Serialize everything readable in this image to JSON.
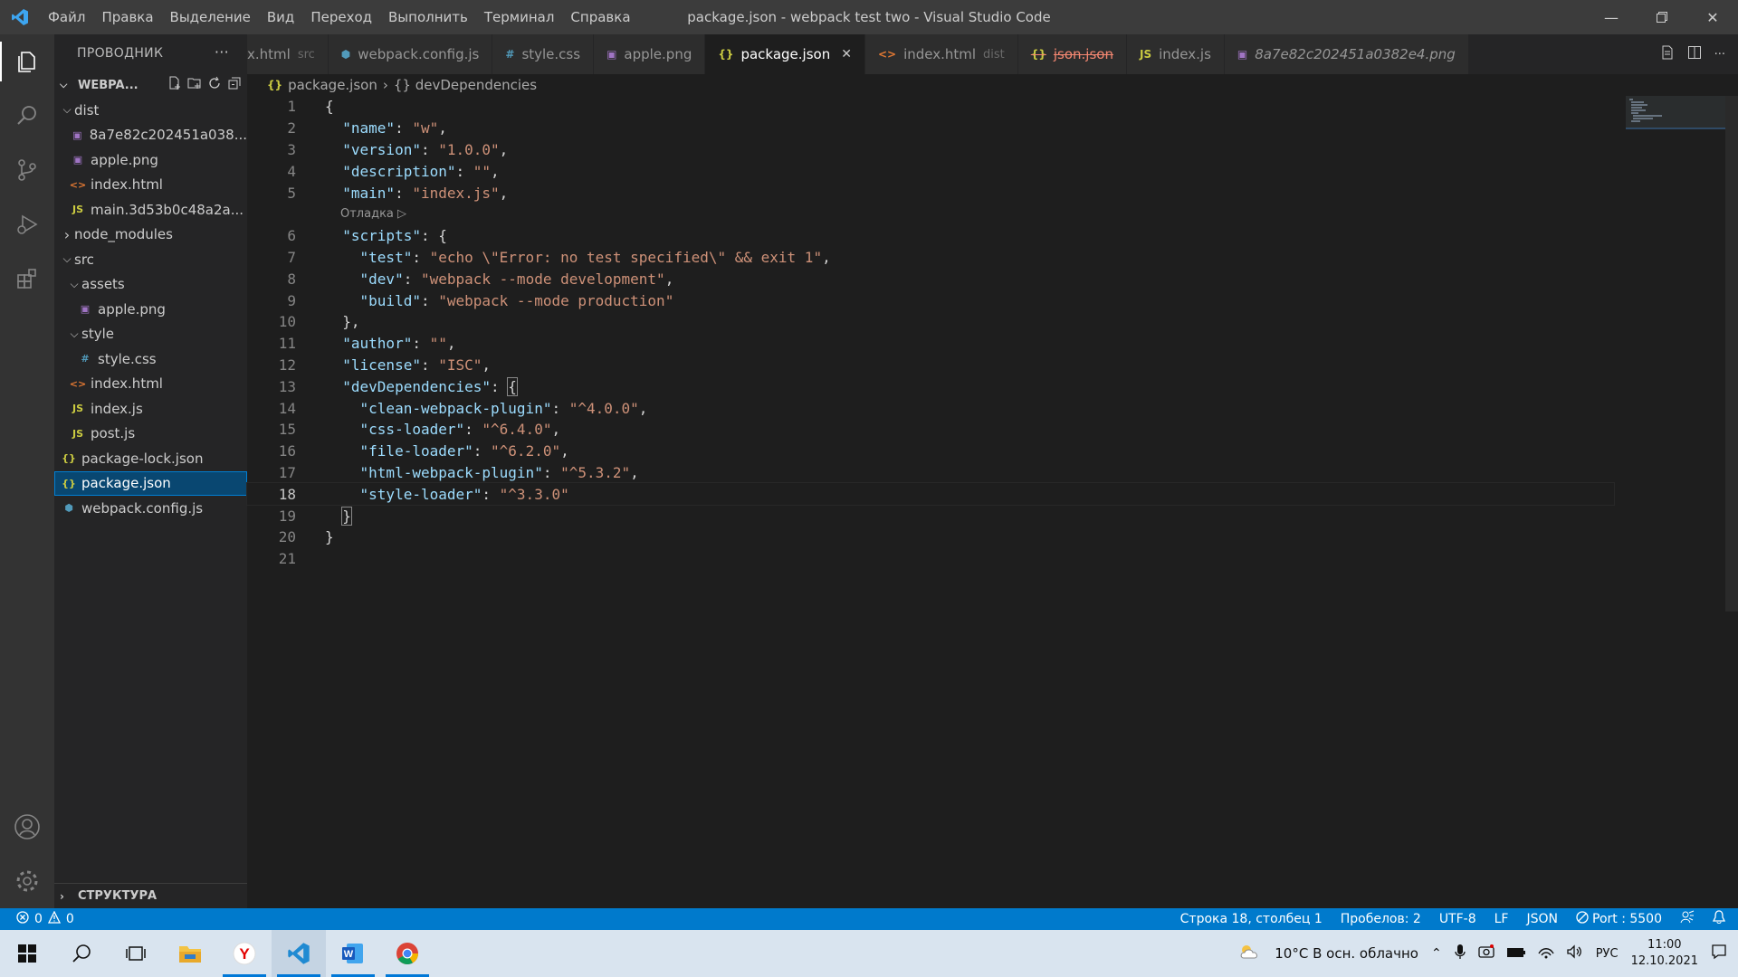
{
  "window": {
    "title": "package.json - webpack test two - Visual Studio Code",
    "menu": [
      "Файл",
      "Правка",
      "Выделение",
      "Вид",
      "Переход",
      "Выполнить",
      "Терминал",
      "Справка"
    ]
  },
  "sidebar": {
    "header": "ПРОВОДНИК",
    "root": "WEBPA...",
    "tree": [
      {
        "label": "dist",
        "type": "folder",
        "depth": 0,
        "expanded": true
      },
      {
        "label": "8a7e82c202451a038...",
        "type": "img",
        "depth": 1
      },
      {
        "label": "apple.png",
        "type": "img",
        "depth": 1
      },
      {
        "label": "index.html",
        "type": "html",
        "depth": 1
      },
      {
        "label": "main.3d53b0c48a2a...",
        "type": "js",
        "depth": 1
      },
      {
        "label": "node_modules",
        "type": "folder",
        "depth": 0,
        "expanded": false
      },
      {
        "label": "src",
        "type": "folder",
        "depth": 0,
        "expanded": true
      },
      {
        "label": "assets",
        "type": "folder",
        "depth": 1,
        "expanded": true
      },
      {
        "label": "apple.png",
        "type": "img",
        "depth": 2
      },
      {
        "label": "style",
        "type": "folder",
        "depth": 1,
        "expanded": true
      },
      {
        "label": "style.css",
        "type": "css",
        "depth": 2
      },
      {
        "label": "index.html",
        "type": "html",
        "depth": 1
      },
      {
        "label": "index.js",
        "type": "js",
        "depth": 1
      },
      {
        "label": "post.js",
        "type": "js",
        "depth": 1
      },
      {
        "label": "package-lock.json",
        "type": "json",
        "depth": 0
      },
      {
        "label": "package.json",
        "type": "json",
        "depth": 0,
        "selected": true
      },
      {
        "label": "webpack.config.js",
        "type": "webpack",
        "depth": 0
      }
    ],
    "outline_label": "СТРУКТУРА"
  },
  "tabs": [
    {
      "label": "x.html",
      "sub": "src",
      "type": "none"
    },
    {
      "label": "webpack.config.js",
      "sub": "",
      "type": "webpack"
    },
    {
      "label": "style.css",
      "sub": "",
      "type": "css"
    },
    {
      "label": "apple.png",
      "sub": "",
      "type": "img"
    },
    {
      "label": "package.json",
      "sub": "",
      "type": "json",
      "active": true
    },
    {
      "label": "index.html",
      "sub": "dist",
      "type": "html"
    },
    {
      "label": "json.json",
      "sub": "",
      "type": "json",
      "error": true
    },
    {
      "label": "index.js",
      "sub": "",
      "type": "js"
    },
    {
      "label": "8a7e82c202451a0382e4.png",
      "sub": "",
      "type": "img",
      "italic": true
    }
  ],
  "breadcrumb": [
    "package.json",
    "{} devDependencies"
  ],
  "codelens": "Отладка ▷",
  "code_lines": [
    [
      [
        "p",
        "{"
      ]
    ],
    [
      [
        "p",
        "  "
      ],
      [
        "k",
        "\"name\""
      ],
      [
        "p",
        ": "
      ],
      [
        "s",
        "\"w\""
      ],
      [
        "p",
        ","
      ]
    ],
    [
      [
        "p",
        "  "
      ],
      [
        "k",
        "\"version\""
      ],
      [
        "p",
        ": "
      ],
      [
        "s",
        "\"1.0.0\""
      ],
      [
        "p",
        ","
      ]
    ],
    [
      [
        "p",
        "  "
      ],
      [
        "k",
        "\"description\""
      ],
      [
        "p",
        ": "
      ],
      [
        "s",
        "\"\""
      ],
      [
        "p",
        ","
      ]
    ],
    [
      [
        "p",
        "  "
      ],
      [
        "k",
        "\"main\""
      ],
      [
        "p",
        ": "
      ],
      [
        "s",
        "\"index.js\""
      ],
      [
        "p",
        ","
      ]
    ],
    [
      [
        "p",
        "  "
      ],
      [
        "k",
        "\"scripts\""
      ],
      [
        "p",
        ": {"
      ]
    ],
    [
      [
        "p",
        "    "
      ],
      [
        "k",
        "\"test\""
      ],
      [
        "p",
        ": "
      ],
      [
        "s",
        "\"echo \\\"Error: no test specified\\\" && exit 1\""
      ],
      [
        "p",
        ","
      ]
    ],
    [
      [
        "p",
        "    "
      ],
      [
        "k",
        "\"dev\""
      ],
      [
        "p",
        ": "
      ],
      [
        "s",
        "\"webpack --mode development\""
      ],
      [
        "p",
        ","
      ]
    ],
    [
      [
        "p",
        "    "
      ],
      [
        "k",
        "\"build\""
      ],
      [
        "p",
        ": "
      ],
      [
        "s",
        "\"webpack --mode production\""
      ]
    ],
    [
      [
        "p",
        "  },"
      ]
    ],
    [
      [
        "p",
        "  "
      ],
      [
        "k",
        "\"author\""
      ],
      [
        "p",
        ": "
      ],
      [
        "s",
        "\"\""
      ],
      [
        "p",
        ","
      ]
    ],
    [
      [
        "p",
        "  "
      ],
      [
        "k",
        "\"license\""
      ],
      [
        "p",
        ": "
      ],
      [
        "s",
        "\"ISC\""
      ],
      [
        "p",
        ","
      ]
    ],
    [
      [
        "p",
        "  "
      ],
      [
        "k",
        "\"devDependencies\""
      ],
      [
        "p",
        ": "
      ],
      [
        "b",
        "{"
      ]
    ],
    [
      [
        "p",
        "    "
      ],
      [
        "k",
        "\"clean-webpack-plugin\""
      ],
      [
        "p",
        ": "
      ],
      [
        "s",
        "\"^4.0.0\""
      ],
      [
        "p",
        ","
      ]
    ],
    [
      [
        "p",
        "    "
      ],
      [
        "k",
        "\"css-loader\""
      ],
      [
        "p",
        ": "
      ],
      [
        "s",
        "\"^6.4.0\""
      ],
      [
        "p",
        ","
      ]
    ],
    [
      [
        "p",
        "    "
      ],
      [
        "k",
        "\"file-loader\""
      ],
      [
        "p",
        ": "
      ],
      [
        "s",
        "\"^6.2.0\""
      ],
      [
        "p",
        ","
      ]
    ],
    [
      [
        "p",
        "    "
      ],
      [
        "k",
        "\"html-webpack-plugin\""
      ],
      [
        "p",
        ": "
      ],
      [
        "s",
        "\"^5.3.2\""
      ],
      [
        "p",
        ","
      ]
    ],
    [
      [
        "p",
        "    "
      ],
      [
        "k",
        "\"style-loader\""
      ],
      [
        "p",
        ": "
      ],
      [
        "s",
        "\"^3.3.0\""
      ]
    ],
    [
      [
        "p",
        "  "
      ],
      [
        "b",
        "}"
      ]
    ],
    [
      [
        "p",
        "}"
      ]
    ],
    [
      [
        "p",
        ""
      ]
    ]
  ],
  "current_line": 18,
  "statusbar": {
    "errors": "0",
    "warnings": "0",
    "position": "Строка 18, столбец 1",
    "spaces": "Пробелов: 2",
    "encoding": "UTF-8",
    "eol": "LF",
    "language": "JSON",
    "port": "Port : 5500"
  },
  "taskbar": {
    "weather": "10°C  В осн. облачно",
    "lang": "РУС",
    "time": "11:00",
    "date": "12.10.2021"
  },
  "colors": {
    "accent": "#007acc",
    "selection": "#094771"
  }
}
